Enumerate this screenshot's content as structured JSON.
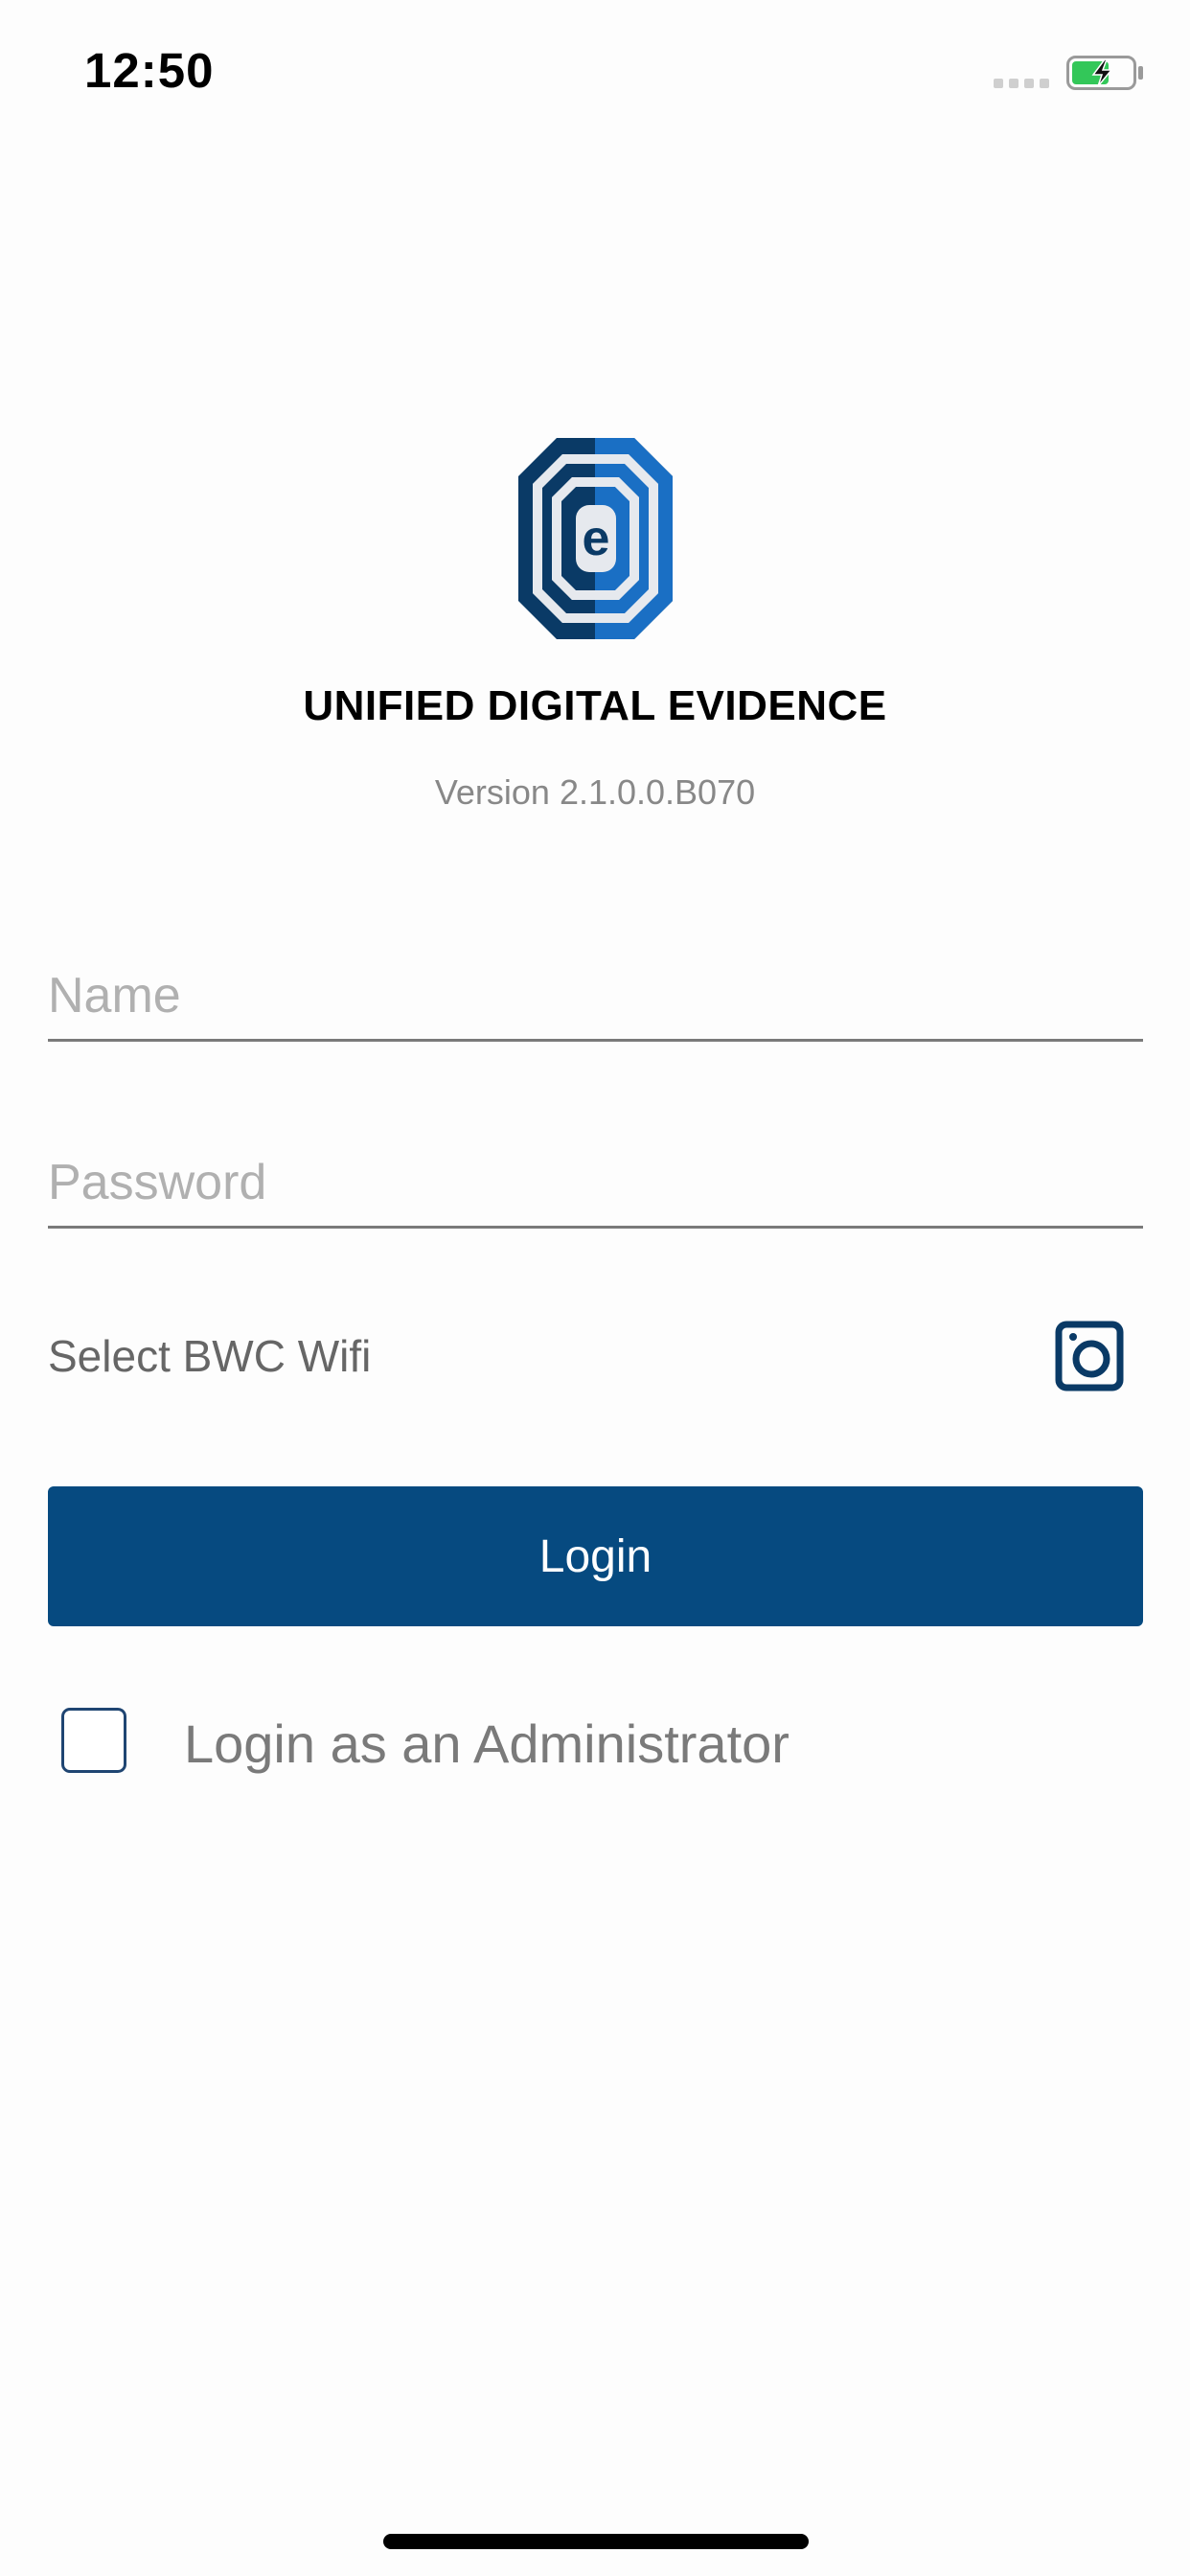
{
  "status_bar": {
    "time": "12:50",
    "battery_state": "charging",
    "battery_color": "#33c759",
    "signal_icon": "signal-dots-icon"
  },
  "branding": {
    "logo_icon": "unified-digital-evidence-logo-icon",
    "app_title": "UNIFIED DIGITAL EVIDENCE",
    "version": "Version 2.1.0.0.B070",
    "logo_colors": {
      "dark_blue": "#0a3a66",
      "bright_blue": "#1a6fc4",
      "light_gray": "#e6e9ee"
    }
  },
  "form": {
    "name_placeholder": "Name",
    "name_value": "",
    "password_placeholder": "Password",
    "password_value": "",
    "wifi_label": "Select BWC Wifi",
    "wifi_icon": "camera-icon",
    "login_label": "Login",
    "admin_label": "Login as an Administrator",
    "admin_checked": false
  },
  "colors": {
    "primary": "#064a80",
    "checkbox_border": "#1f4572",
    "underline": "#7a7a7a"
  }
}
